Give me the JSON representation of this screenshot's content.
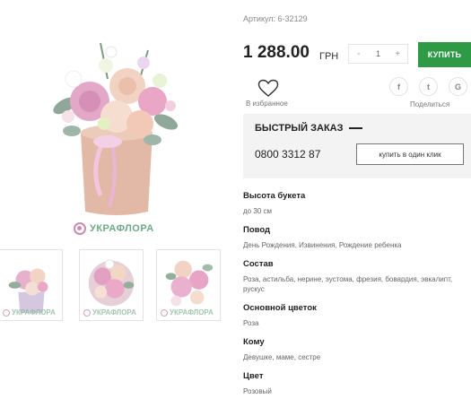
{
  "brand": {
    "logo_text": "УКРАФЛОРА",
    "accent": "#2e9a45",
    "logo_pink": "#c78db1",
    "logo_green": "#6fa985"
  },
  "product": {
    "article": "Артикул: 6-32129",
    "price": "1 288.00",
    "currency": "ГРН",
    "quantity": "1",
    "qty_minus": "-",
    "qty_plus": "+",
    "buy_label": "КУПИТЬ"
  },
  "favorite": {
    "label": "В избранное",
    "icon": "heart-icon"
  },
  "share": {
    "label": "Поделиться",
    "buttons": [
      {
        "glyph": "f",
        "icon": "facebook-icon"
      },
      {
        "glyph": "t",
        "icon": "twitter-icon"
      },
      {
        "glyph": "G",
        "icon": "google-plus-icon"
      }
    ]
  },
  "quick_order": {
    "title": "БЫСТРЫЙ ЗАКАЗ",
    "phone": "0800 3312 87",
    "button_label": "купить в один клик"
  },
  "specs": [
    {
      "label": "Высота букета",
      "value": "до 30 см"
    },
    {
      "label": "Повод",
      "value": "День Рождения, Извинения, Рождение ребенка"
    },
    {
      "label": "Состав",
      "value": "Роза, астильба, нерине, эустома, фрезия, бовардия, эвкалипт, рускус"
    },
    {
      "label": "Основной цветок",
      "value": "Роза"
    },
    {
      "label": "Кому",
      "value": "Девушке, маме, сестре"
    },
    {
      "label": "Цвет",
      "value": "Розовый"
    }
  ]
}
